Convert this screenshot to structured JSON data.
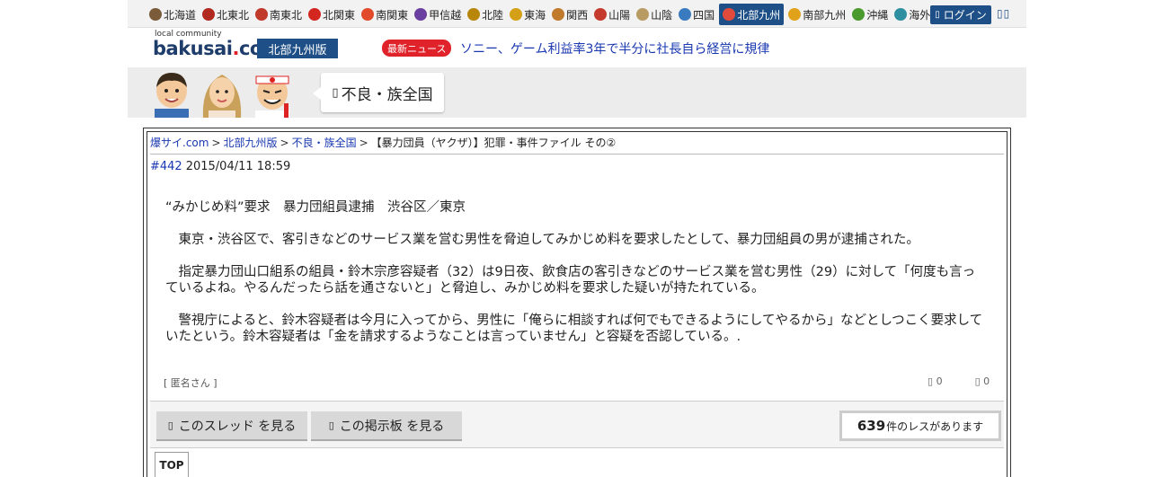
{
  "regions": [
    {
      "label": "北海道",
      "icon": "hokkaido-icon",
      "color": "#7a5b3a",
      "active": false
    },
    {
      "label": "北東北",
      "icon": "namahage-icon",
      "color": "#b02a20",
      "active": false
    },
    {
      "label": "南東北",
      "icon": "beef-tongue-icon",
      "color": "#c0392b",
      "active": false
    },
    {
      "label": "北関東",
      "icon": "daruma-icon",
      "color": "#d2261f",
      "active": false
    },
    {
      "label": "南関東",
      "icon": "tokyo-tower-icon",
      "color": "#e14b2b",
      "active": false
    },
    {
      "label": "甲信越",
      "icon": "grape-icon",
      "color": "#6b3fa0",
      "active": false
    },
    {
      "label": "北陸",
      "icon": "torii-icon",
      "color": "#b8860b",
      "active": false
    },
    {
      "label": "東海",
      "icon": "shachihoko-icon",
      "color": "#d4a017",
      "active": false
    },
    {
      "label": "関西",
      "icon": "takoyaki-icon",
      "color": "#c07a2c",
      "active": false
    },
    {
      "label": "山陽",
      "icon": "shrine-gate-icon",
      "color": "#c43b2e",
      "active": false
    },
    {
      "label": "山陰",
      "icon": "rabbit-icon",
      "color": "#b89b62",
      "active": false
    },
    {
      "label": "四国",
      "icon": "udon-icon",
      "color": "#3a7bbf",
      "active": false
    },
    {
      "label": "北部九州",
      "icon": "mentaiko-icon",
      "color": "#e24b3b",
      "active": true
    },
    {
      "label": "南部九州",
      "icon": "mango-icon",
      "color": "#e0a21b",
      "active": false
    },
    {
      "label": "沖縄",
      "icon": "shisa-icon",
      "color": "#4a9a2e",
      "active": false
    },
    {
      "label": "海外",
      "icon": "globe-icon",
      "color": "#2e8fa0",
      "active": false
    }
  ],
  "header": {
    "login_label": "ログイン",
    "menu_glyph": "▯▯",
    "logo_small": "local community",
    "logo_text_main": "bakusai",
    "logo_text_dot": ".",
    "logo_text_tld": "com",
    "edition_label": "北部九州版"
  },
  "news": {
    "badge": "最新ニュース",
    "headline": "ソニー、ゲーム利益率3年で半分に社長自ら経営に規律"
  },
  "category": {
    "title": "不良・族全国",
    "icon_glyph": "▯"
  },
  "breadcrumb": {
    "items": [
      "爆サイ.com",
      "北部九州版",
      "不良・族全国"
    ],
    "current": "【暴力団員（ヤクザ）】犯罪・事件ファイル その②",
    "separator": ">"
  },
  "post": {
    "number": "#442",
    "datetime": "2015/04/11 18:59",
    "paragraphs": [
      "“みかじめ料”要求　暴力団組員逮捕　渋谷区／東京",
      "　東京・渋谷区で、客引きなどのサービス業を営む男性を脅迫してみかじめ料を要求したとして、暴力団組員の男が逮捕された。",
      "　指定暴力団山口組系の組員・鈴木宗彦容疑者（32）は9日夜、飲食店の客引きなどのサービス業を営む男性（29）に対して「何度も言っているよね。やるんだったら話を通さないと」と脅迫し、みかじめ料を要求した疑いが持たれている。",
      "　警視庁によると、鈴木容疑者は今月に入ってから、男性に「俺らに相談すれば何でもできるようにしてやるから」などとしつこく要求していたという。鈴木容疑者は「金を請求するようなことは言っていません」と容疑を否認している。."
    ],
    "author": "[ 匿名さん ]",
    "like_count": "0",
    "dislike_count": "0",
    "like_glyph": "▯",
    "dislike_glyph": "▯"
  },
  "actions": {
    "thread_button": "このスレッド を見る",
    "board_button": "この掲示板 を見る",
    "button_glyph": "▯",
    "res_count": "639",
    "res_suffix": "件のレスがあります",
    "top_label": "TOP"
  }
}
